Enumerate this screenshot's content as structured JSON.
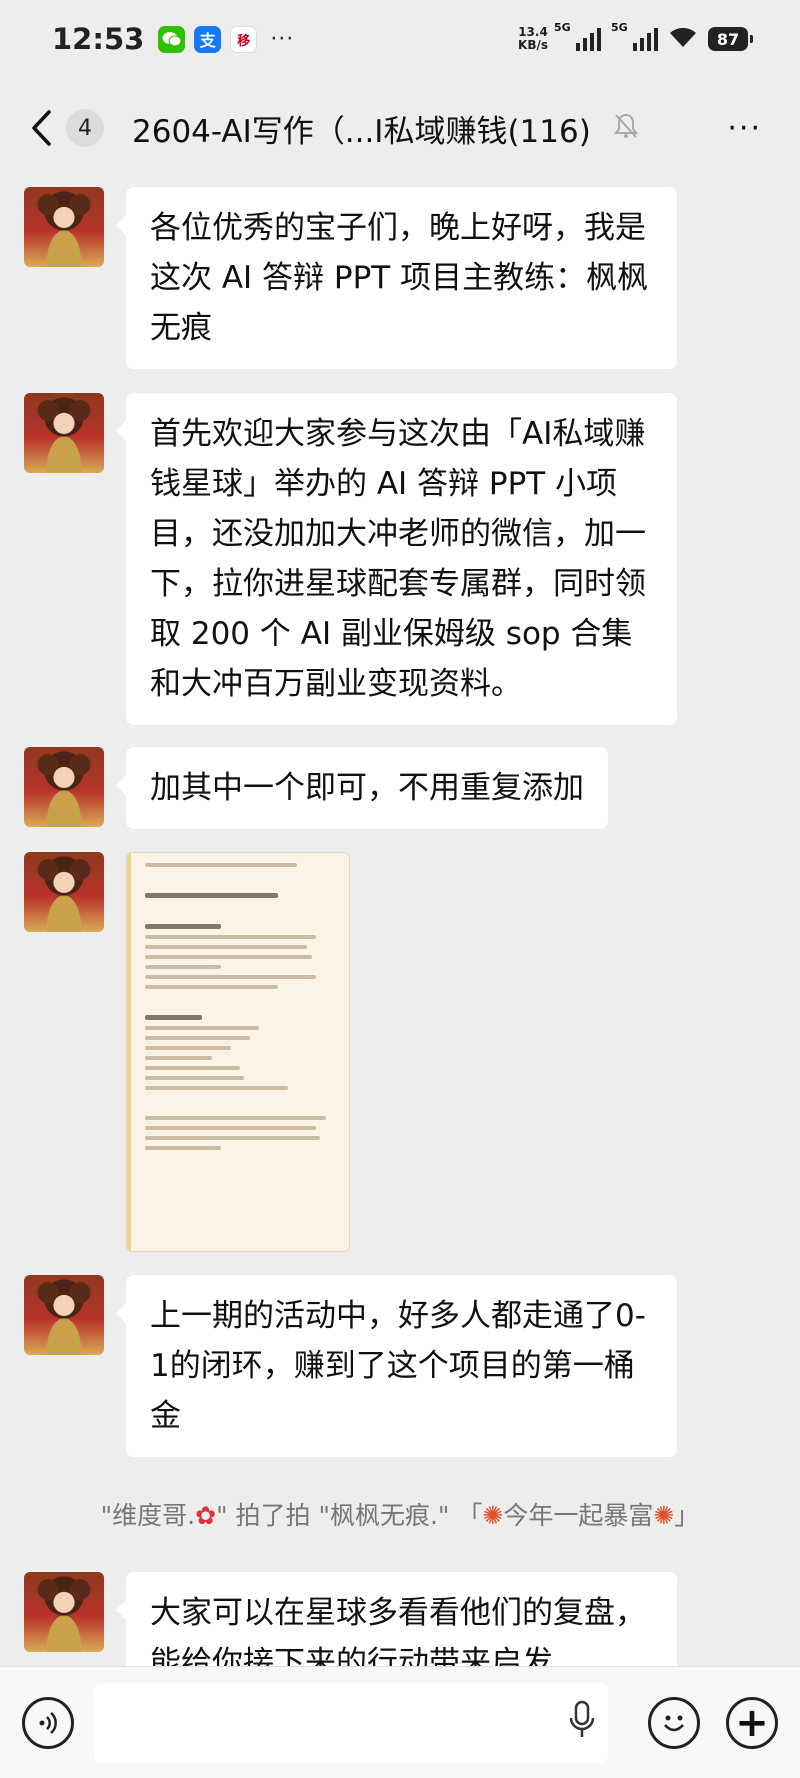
{
  "status_bar": {
    "time": "12:53",
    "app_icons": [
      "wechat-icon",
      "alipay-icon",
      "china-mobile-icon"
    ],
    "alipay_glyph": "支",
    "mobile_glyph": "移",
    "more": "···",
    "net_speed_value": "13.4",
    "net_speed_unit": "KB/s",
    "sim1_label": "5G",
    "sim2_label": "5G",
    "battery": "87"
  },
  "nav": {
    "unread_count": "4",
    "title": "2604-AI写作（...I私域赚钱(116)",
    "more": "···"
  },
  "messages": [
    {
      "type": "text",
      "text": "各位优秀的宝子们，晚上好呀，我是这次 AI 答辩 PPT 项目主教练：枫枫无痕"
    },
    {
      "type": "text",
      "text": "首先欢迎大家参与这次由「AI私域赚钱星球」举办的 AI 答辩 PPT 小项目，还没加加大冲老师的微信，加一下，拉你进星球配套专属群，同时领取 200 个 AI 副业保姆级 sop 合集和大冲百万副业变现资料。"
    },
    {
      "type": "text",
      "text": "加其中一个即可，不用重复添加"
    },
    {
      "type": "image",
      "description": "document-image"
    },
    {
      "type": "text",
      "text": "上一期的活动中，好多人都走通了0-1的闭环，赚到了这个项目的第一桶金"
    },
    {
      "type": "text",
      "text": "大家可以在星球多看看他们的复盘，能给你接下来的行动带来启发"
    }
  ],
  "system_note": {
    "actor": "\"维度哥.",
    "actor_suffix": "\" 拍了拍 \"枫枫无痕.\" 「",
    "suffix_text": "今年一起暴富",
    "close": "」",
    "flower": "✿",
    "firework": "✺"
  },
  "input_bar": {
    "voice_icon": "voice-icon",
    "placeholder": "",
    "mic_icon": "mic-icon",
    "emoji_icon": "emoji-icon",
    "plus": "+"
  },
  "colors": {
    "background": "#ededed",
    "bubble": "#ffffff",
    "wechat_green": "#2dc100",
    "alipay_blue": "#1677ff"
  }
}
